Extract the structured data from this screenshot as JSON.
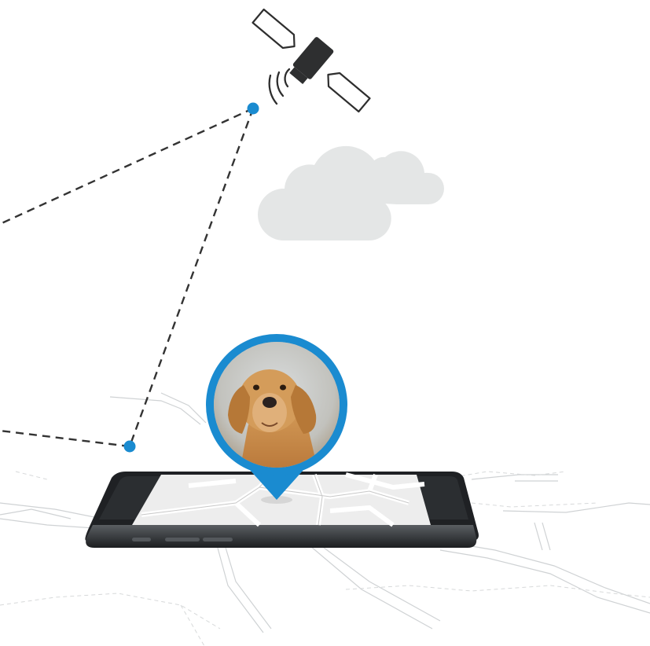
{
  "illustration": {
    "satellite_icon": "satellite-icon",
    "signal_icon": "signal-waves-icon",
    "cloud_icon": "cloud-icon",
    "phone_icon": "smartphone-icon",
    "pin_icon": "location-pin-icon",
    "pet_photo": "dog-photo"
  },
  "colors": {
    "accent": "#1a8bd0",
    "line": "#333333",
    "cloud": "#e4e6e6",
    "phone_body": "#2b2e31",
    "map_screen": "#eeeeee",
    "map_roads": "#d4d4d4"
  }
}
